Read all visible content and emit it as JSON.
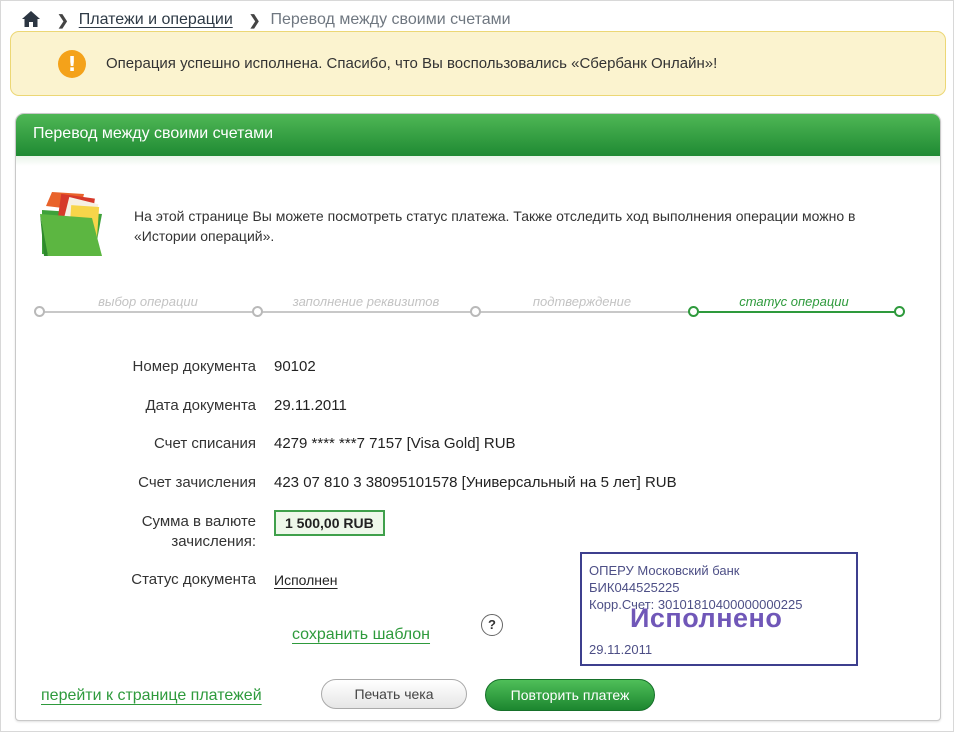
{
  "breadcrumb": {
    "home_icon": "home-icon",
    "section": "Платежи и операции",
    "current": "Перевод между своими счетами"
  },
  "banner": {
    "icon": "info-icon",
    "message": "Операция успешно исполнена. Спасибо, что Вы воспользовались «Сбербанк Онлайн»!"
  },
  "panel": {
    "title": "Перевод между своими счетами",
    "intro": "На этой странице Вы можете посмотреть статус платежа. Также отследить ход выполнения операции можно в «Истории операций».",
    "steps": [
      {
        "label": "выбор операции",
        "active": false
      },
      {
        "label": "заполнение реквизитов",
        "active": false
      },
      {
        "label": "подтверждение",
        "active": false
      },
      {
        "label": "статус операции",
        "active": true
      }
    ],
    "fields": [
      {
        "label": "Номер документа",
        "value": "90102"
      },
      {
        "label": "Дата документа",
        "value": "29.11.2011"
      },
      {
        "label": "Счет списания",
        "value": "4279 **** ***7 7157  [Visa Gold]  RUB"
      },
      {
        "label": "Счет зачисления",
        "value": "423 07 810 3 38095101578  [Универсальный на 5 лет]  RUB"
      },
      {
        "label": "Сумма в валюте зачисления:",
        "value": "1 500,00  RUB"
      },
      {
        "label": "Статус документа",
        "value": "Исполнен"
      }
    ],
    "save_template": "сохранить шаблон",
    "help": "?",
    "stamp": {
      "line1": "ОПЕРУ Московский банк",
      "line2": "БИК044525225",
      "line3": "Корр.Счет: 30101810400000000225",
      "status": "Исполнено",
      "date": "29.11.2011"
    },
    "goto_payments": "перейти к странице платежей",
    "print_button": "Печать чека",
    "repeat_button": "Повторить платеж"
  },
  "colors": {
    "accent_green": "#2e9a3c",
    "banner_bg": "#fbf3cf",
    "stamp_border": "#3d3f8e",
    "stamp_text": "#7057b8"
  }
}
